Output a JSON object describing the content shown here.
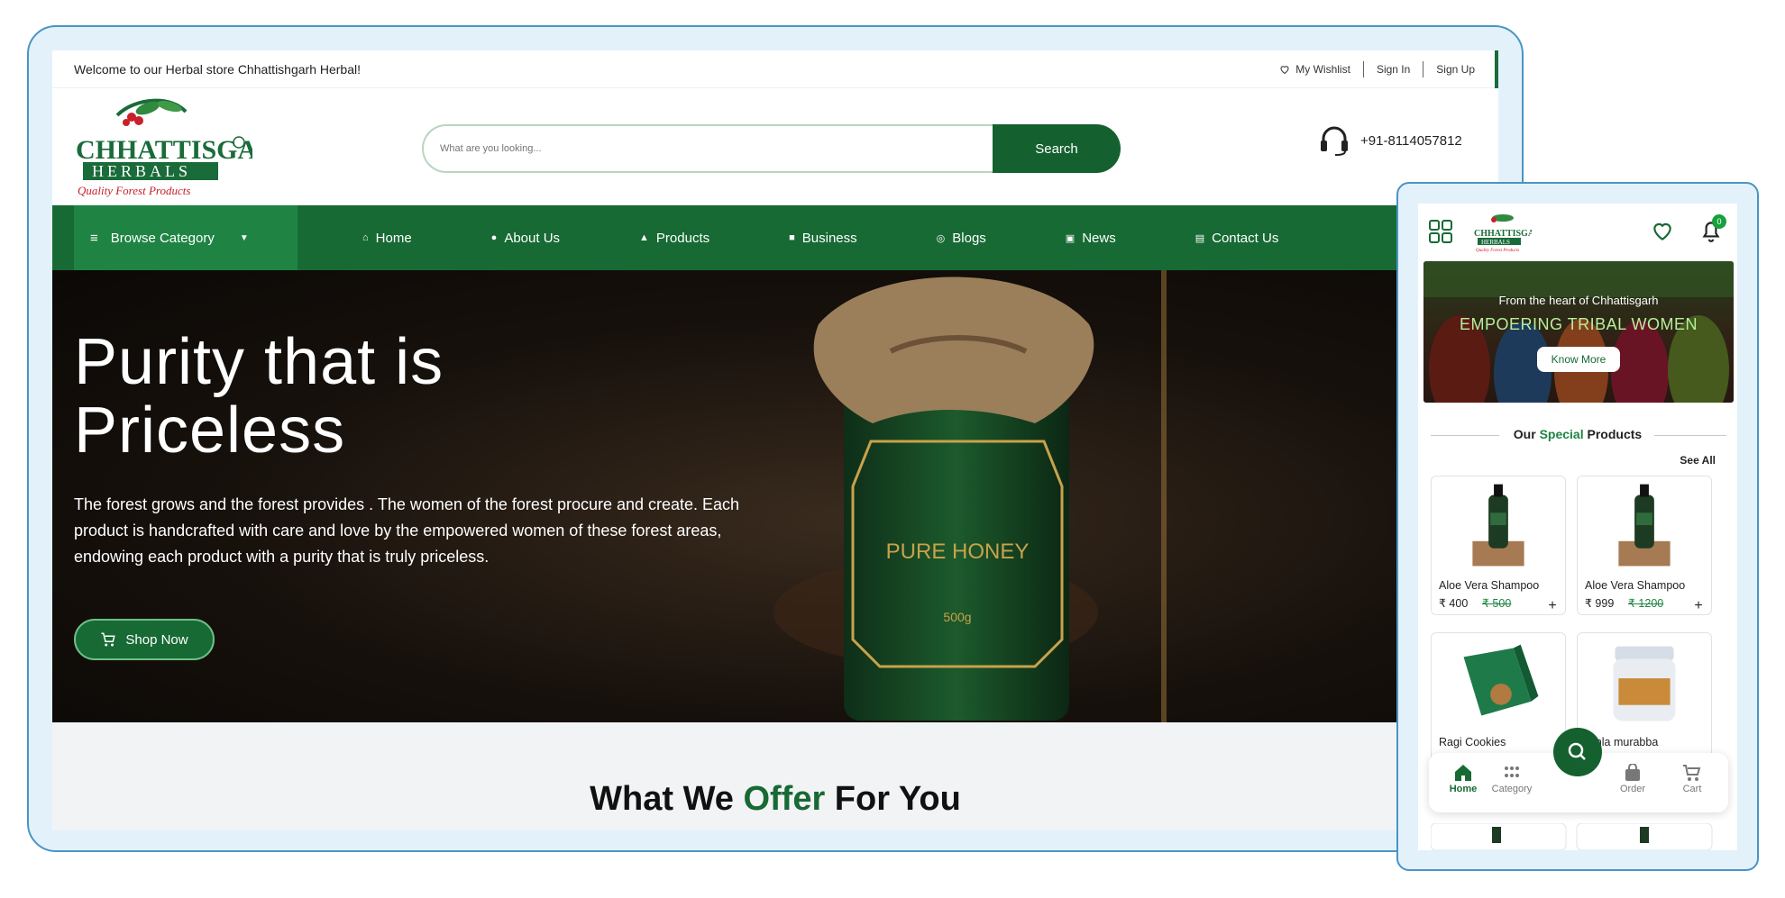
{
  "desktop": {
    "topbar": {
      "welcome": "Welcome to our Herbal store Chhattishgarh Herbal!",
      "wishlist": "My Wishlist",
      "signin": "Sign In",
      "signup": "Sign Up"
    },
    "brand": {
      "logo_line1": "CHHATTISGARH",
      "logo_line2": "HERBALS",
      "tagline": "Quality Forest Products"
    },
    "search": {
      "placeholder": "What are you looking...",
      "button": "Search"
    },
    "phone": "+91-8114057812",
    "nav": {
      "browse": "Browse Category",
      "items": [
        {
          "label": "Home",
          "icon": "home-icon"
        },
        {
          "label": "About Us",
          "icon": "info-icon"
        },
        {
          "label": "Products",
          "icon": "products-icon"
        },
        {
          "label": "Business",
          "icon": "business-icon"
        },
        {
          "label": "Blogs",
          "icon": "blog-icon"
        },
        {
          "label": "News",
          "icon": "news-icon"
        },
        {
          "label": "Contact Us",
          "icon": "contact-icon"
        }
      ]
    },
    "hero": {
      "title_line1": "Purity that is",
      "title_line2": "Priceless",
      "body": "The forest grows and the forest provides . The women of the forest procure and create. Each product is handcrafted with care and love by the empowered women of these forest areas, endowing each product with a purity that is truly priceless.",
      "cta": "Shop Now",
      "jar_label": "PURE HONEY",
      "jar_weight": "500g"
    },
    "offer": {
      "pre": "What We ",
      "highlight": "Offer",
      "post": " For You"
    }
  },
  "mobile": {
    "notification_count": "0",
    "banner": {
      "line1": "From the heart of Chhattisgarh",
      "line2": "EMPOERING TRIBAL WOMEN",
      "button": "Know More"
    },
    "section": {
      "pre": "Our ",
      "highlight": "Special",
      "post": " Products",
      "see_all": "See All"
    },
    "products": [
      {
        "name": "Aloe Vera Shampoo",
        "price": "₹ 400",
        "old_price": "₹ 500"
      },
      {
        "name": "Aloe Vera Shampoo",
        "price": "₹ 999",
        "old_price": "₹ 1200"
      },
      {
        "name": "Ragi Cookies"
      },
      {
        "name": "Amla murabba"
      }
    ],
    "bottom_nav": {
      "home": "Home",
      "category": "Category",
      "order": "Order",
      "cart": "Cart"
    }
  },
  "colors": {
    "brand_green": "#176a34",
    "accent_green": "#1f8443",
    "frame_blue": "#4a95c4",
    "frame_bg": "#e3f1fb"
  }
}
